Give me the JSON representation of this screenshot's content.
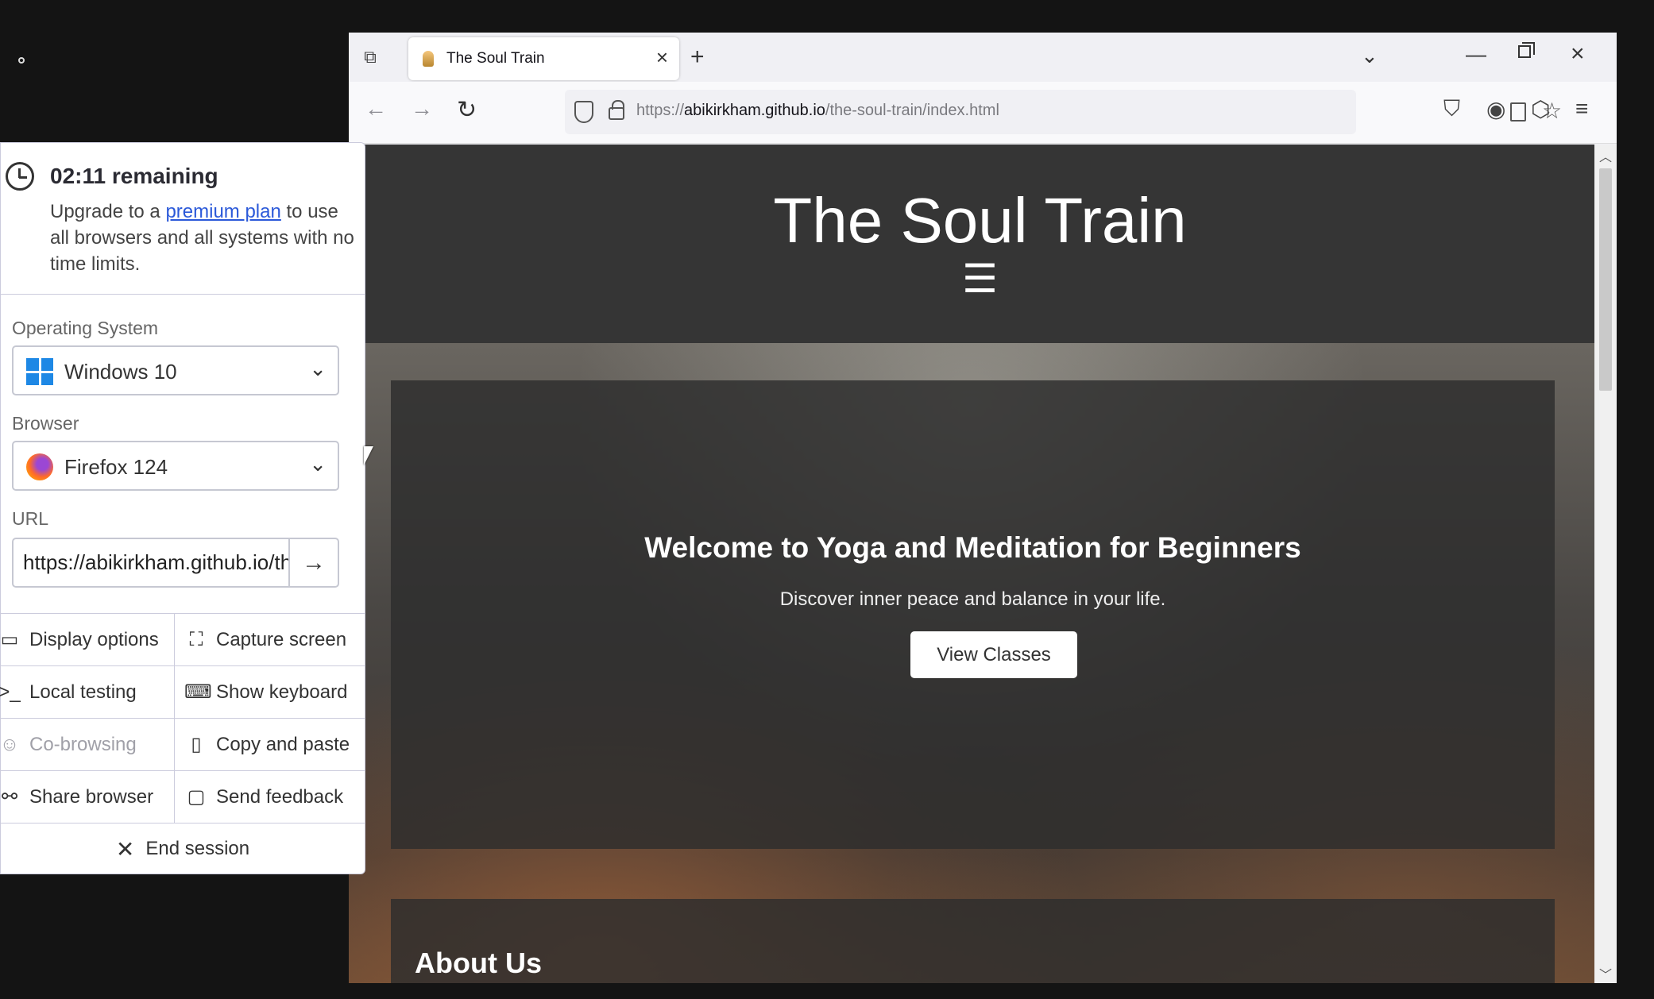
{
  "browser": {
    "tab_title": "The Soul Train",
    "url_prefix": "https://",
    "url_domain": "abikirkham.github.io",
    "url_path": "/the-soul-train/index.html"
  },
  "site": {
    "title": "The Soul Train",
    "menu_glyph": "☰",
    "hero_heading": "Welcome to Yoga and Meditation for Beginners",
    "hero_sub": "Discover inner peace and balance in your life.",
    "hero_button": "View Classes",
    "about_heading": "About Us"
  },
  "panel": {
    "timer": "02:11 remaining",
    "upgrade_pre": "Upgrade to a ",
    "upgrade_link": "premium plan",
    "upgrade_post": " to use all browsers and all systems with no time limits.",
    "os_label": "Operating System",
    "os_value": "Windows 10",
    "browser_label": "Browser",
    "browser_value": "Firefox 124",
    "url_label": "URL",
    "url_value": "https://abikirkham.github.io/the-soul-train/index.html",
    "options": [
      {
        "label": "Display options",
        "icon": "monitor-icon"
      },
      {
        "label": "Capture screen",
        "icon": "capture-icon"
      },
      {
        "label": "Local testing",
        "icon": "terminal-icon"
      },
      {
        "label": "Show keyboard",
        "icon": "keyboard-icon"
      },
      {
        "label": "Co-browsing",
        "icon": "users-icon"
      },
      {
        "label": "Copy and paste",
        "icon": "clipboard-icon"
      },
      {
        "label": "Share browser",
        "icon": "link-icon"
      },
      {
        "label": "Send feedback",
        "icon": "message-icon"
      }
    ],
    "end_session": "End session"
  },
  "colors": {
    "link": "#2b59d9",
    "header_bg": "#353535",
    "card_bg": "#2d2d2d"
  }
}
